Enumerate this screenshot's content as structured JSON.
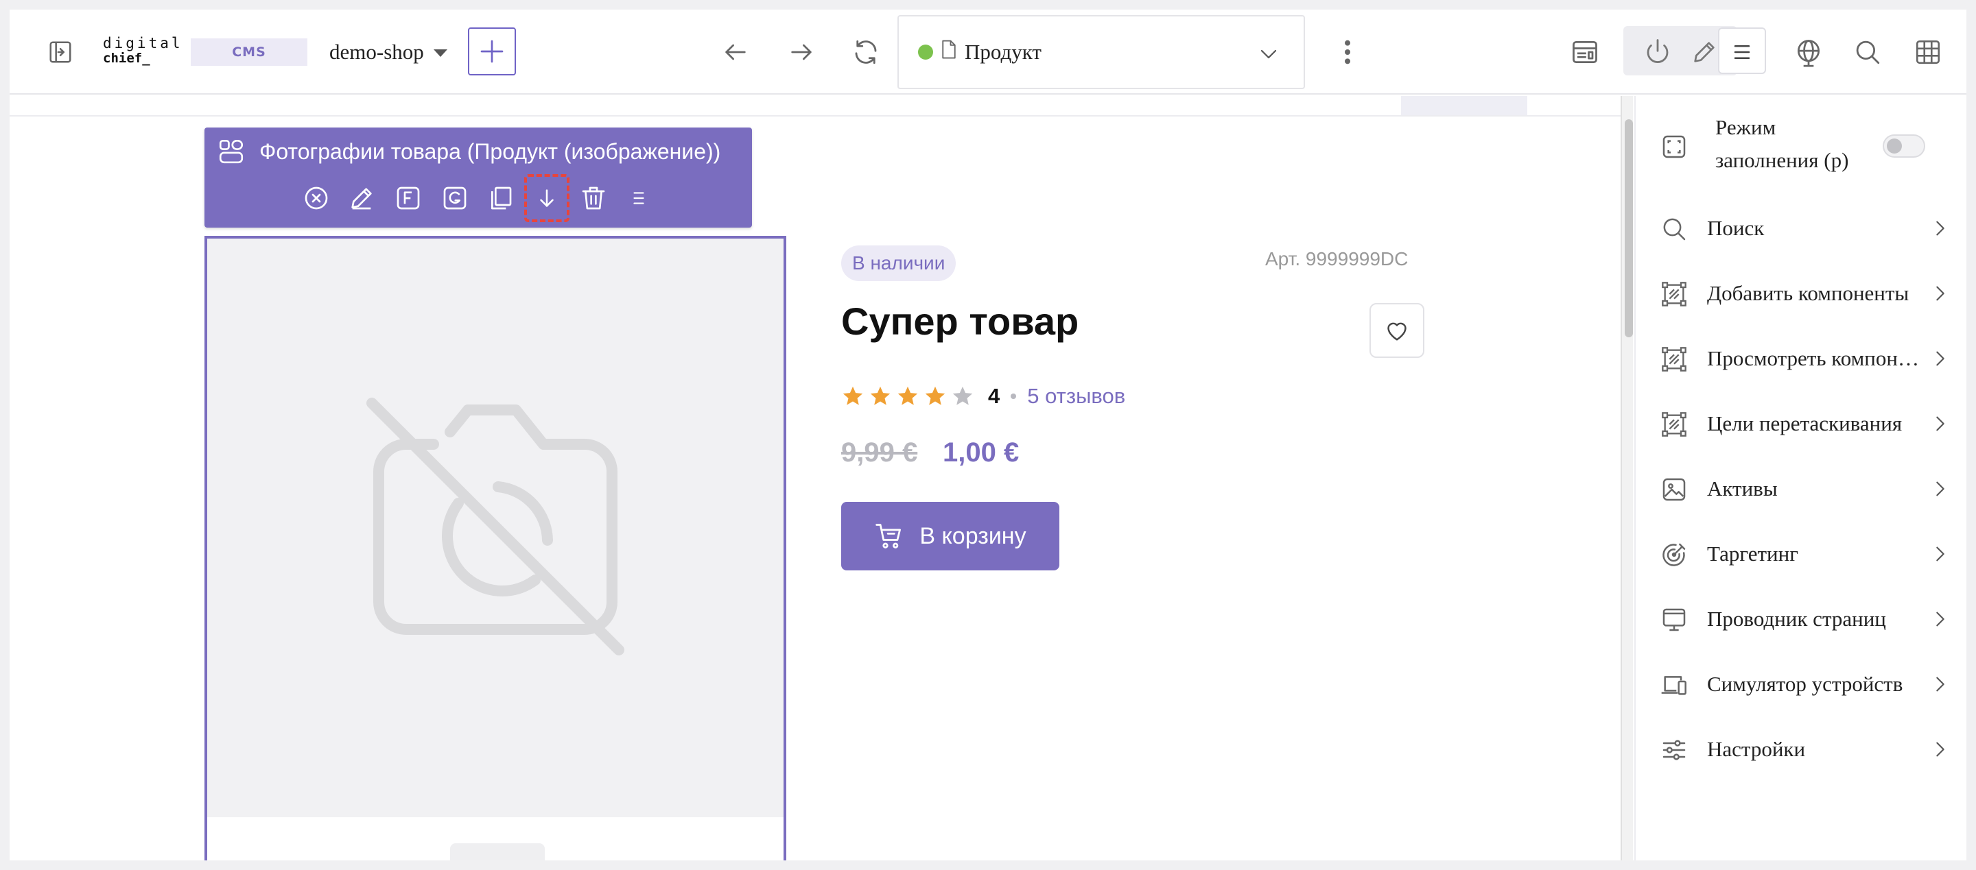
{
  "header": {
    "logo_line1": "digital",
    "logo_line2": "chief_",
    "cms_badge": "CMS",
    "shop": "demo-shop",
    "page": "Продукт"
  },
  "component": {
    "title": "Фотографии товара (Продукт (изображение))",
    "actions": [
      "close-icon",
      "edit-icon",
      "f-icon",
      "g-icon",
      "copy-icon",
      "download-icon",
      "delete-icon",
      "menu-icon"
    ]
  },
  "product": {
    "stock_badge": "В наличии",
    "sku": "Арт. 9999999DC",
    "title": "Супер товар",
    "rating": 4,
    "rating_text": "4",
    "reviews": "5 отзывов",
    "price_old": "9,99 €",
    "price_new": "1,00 €",
    "cart_button": "В корзину"
  },
  "panel": {
    "fill_mode_label": "Режим заполнения (p)",
    "fill_mode_on": false,
    "items": [
      {
        "label": "Поиск",
        "icon": "search-icon"
      },
      {
        "label": "Добавить компоненты",
        "icon": "component-icon"
      },
      {
        "label": "Просмотреть компоненты",
        "icon": "component-icon"
      },
      {
        "label": "Цели перетаскивания",
        "icon": "component-icon"
      },
      {
        "label": "Активы",
        "icon": "image-icon"
      },
      {
        "label": "Таргетинг",
        "icon": "target-icon"
      },
      {
        "label": "Проводник страниц",
        "icon": "monitor-icon"
      },
      {
        "label": "Симулятор устройств",
        "icon": "device-icon"
      },
      {
        "label": "Настройки",
        "icon": "sliders-icon"
      }
    ]
  },
  "colors": {
    "accent": "#7a6dbf",
    "status_green": "#7cc24d",
    "star": "#f0a033",
    "highlight": "#e8453c"
  }
}
